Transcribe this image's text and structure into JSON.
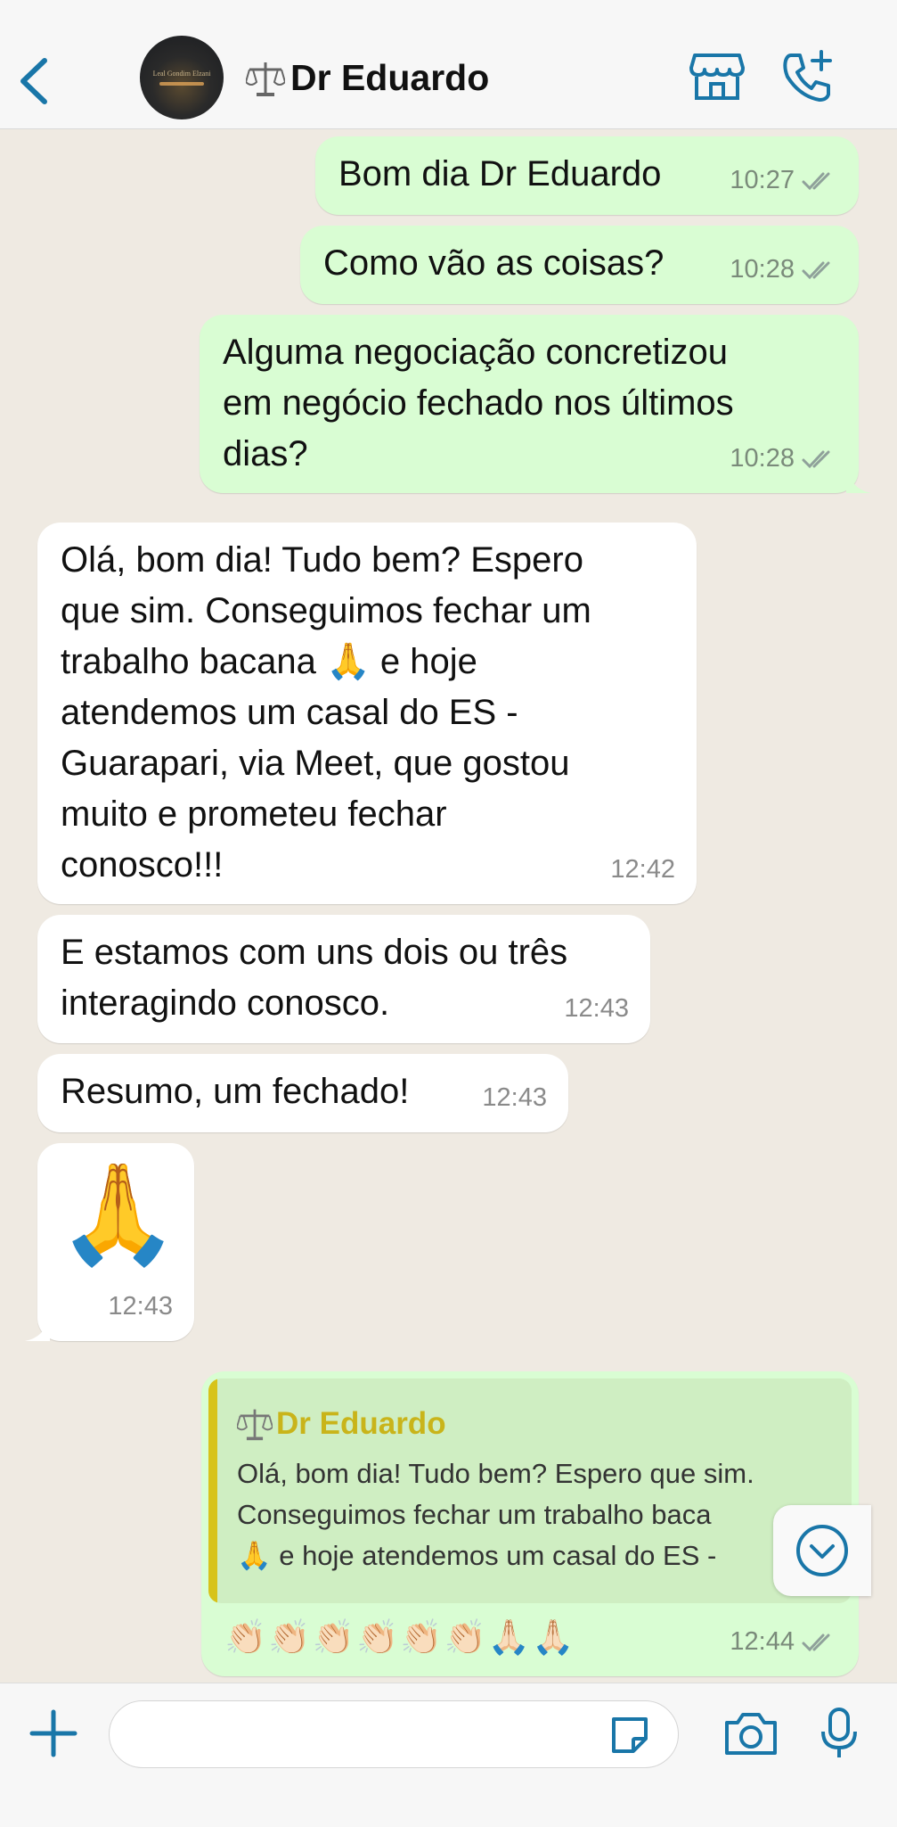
{
  "header": {
    "contact_name": "Dr Eduardo",
    "avatar_text": "Leal Gondim Elzani",
    "back_icon": "chevron-left-icon",
    "store_icon": "storefront-icon",
    "call_icon": "phone-plus-icon",
    "accent_color": "#1976a8"
  },
  "messages": [
    {
      "direction": "out",
      "text": "Bom dia Dr Eduardo",
      "time": "10:27",
      "status": "read"
    },
    {
      "direction": "out",
      "text": "Como vão as coisas?",
      "time": "10:28",
      "status": "read"
    },
    {
      "direction": "out",
      "text": "Alguma negociação concretizou\nem negócio fechado nos últimos\ndias?",
      "time": "10:28",
      "status": "read"
    },
    {
      "direction": "in",
      "text": "Olá, bom dia! Tudo bem? Espero\nque sim. Conseguimos fechar um\ntrabalho bacana 🙏 e hoje\natendemos um casal do ES -\nGuarapari, via Meet, que gostou\nmuito e prometeu fechar\nconosco!!!",
      "time": "12:42"
    },
    {
      "direction": "in",
      "text": "E estamos com uns dois ou três\ninteragindo conosco.",
      "time": "12:43"
    },
    {
      "direction": "in",
      "text": "Resumo, um fechado!",
      "time": "12:43"
    },
    {
      "direction": "in",
      "text": "🙏",
      "time": "12:43"
    },
    {
      "direction": "out",
      "quote_name": "Dr Eduardo",
      "quote_text": "Olá, bom dia! Tudo bem? Espero que sim.\nConseguimos fechar um trabalho baca\n🙏 e hoje atendemos um casal do ES -",
      "text": "👏🏻👏🏻👏🏻👏🏻👏🏻👏🏻🙏🏻🙏🏻",
      "time": "12:44",
      "status": "read"
    }
  ],
  "composer": {
    "placeholder": "",
    "plus_icon": "plus-icon",
    "sticker_icon": "sticker-icon",
    "camera_icon": "camera-icon",
    "mic_icon": "microphone-icon"
  }
}
